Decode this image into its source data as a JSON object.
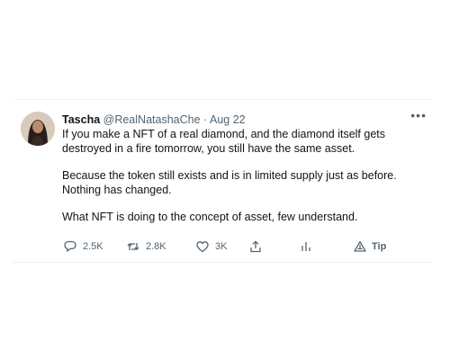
{
  "tweet": {
    "display_name": "Tascha",
    "handle": "@RealNatashaChe",
    "separator": "·",
    "date": "Aug 22",
    "more_label": "•••",
    "paragraphs": [
      "If you make a NFT of a real diamond, and the diamond itself gets destroyed in a fire tomorrow, you still have the same asset.",
      "Because the token still exists and is in limited supply just as before. Nothing has changed.",
      "What NFT is doing to the concept of asset, few understand."
    ]
  },
  "actions": {
    "reply": {
      "icon": "reply-icon",
      "count": "2.5K"
    },
    "retweet": {
      "icon": "retweet-icon",
      "count": "2.8K"
    },
    "like": {
      "icon": "heart-icon",
      "count": "3K"
    },
    "share": {
      "icon": "share-icon"
    },
    "analytics": {
      "icon": "analytics-icon"
    },
    "tip": {
      "icon": "tip-icon",
      "label": "Tip"
    }
  },
  "colors": {
    "text_primary": "#0f1419",
    "text_secondary": "#536471",
    "background": "#ffffff"
  }
}
